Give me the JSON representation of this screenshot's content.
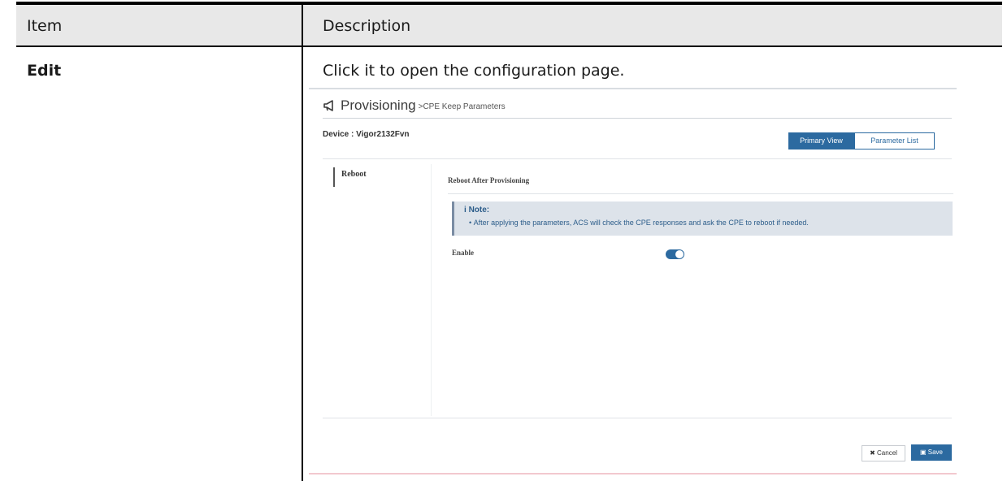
{
  "table": {
    "header_item": "Item",
    "header_description": "Description",
    "row_item": "Edit",
    "row_description": "Click it to open the configuration page."
  },
  "screenshot": {
    "title": "Provisioning",
    "breadcrumb": ">CPE Keep Parameters",
    "device_label": "Device : Vigor2132Fvn",
    "view_buttons": {
      "primary": "Primary View",
      "parameter_list": "Parameter List"
    },
    "tab_label": "Reboot",
    "section_title": "Reboot After Provisioning",
    "note_heading": "Note:",
    "note_text": "After applying the parameters, ACS will check the CPE responses and ask the CPE to reboot if needed.",
    "enable_label": "Enable",
    "enable_on": true,
    "cancel_label": "Cancel",
    "save_label": "Save",
    "accent_color": "#2c6aa0"
  }
}
